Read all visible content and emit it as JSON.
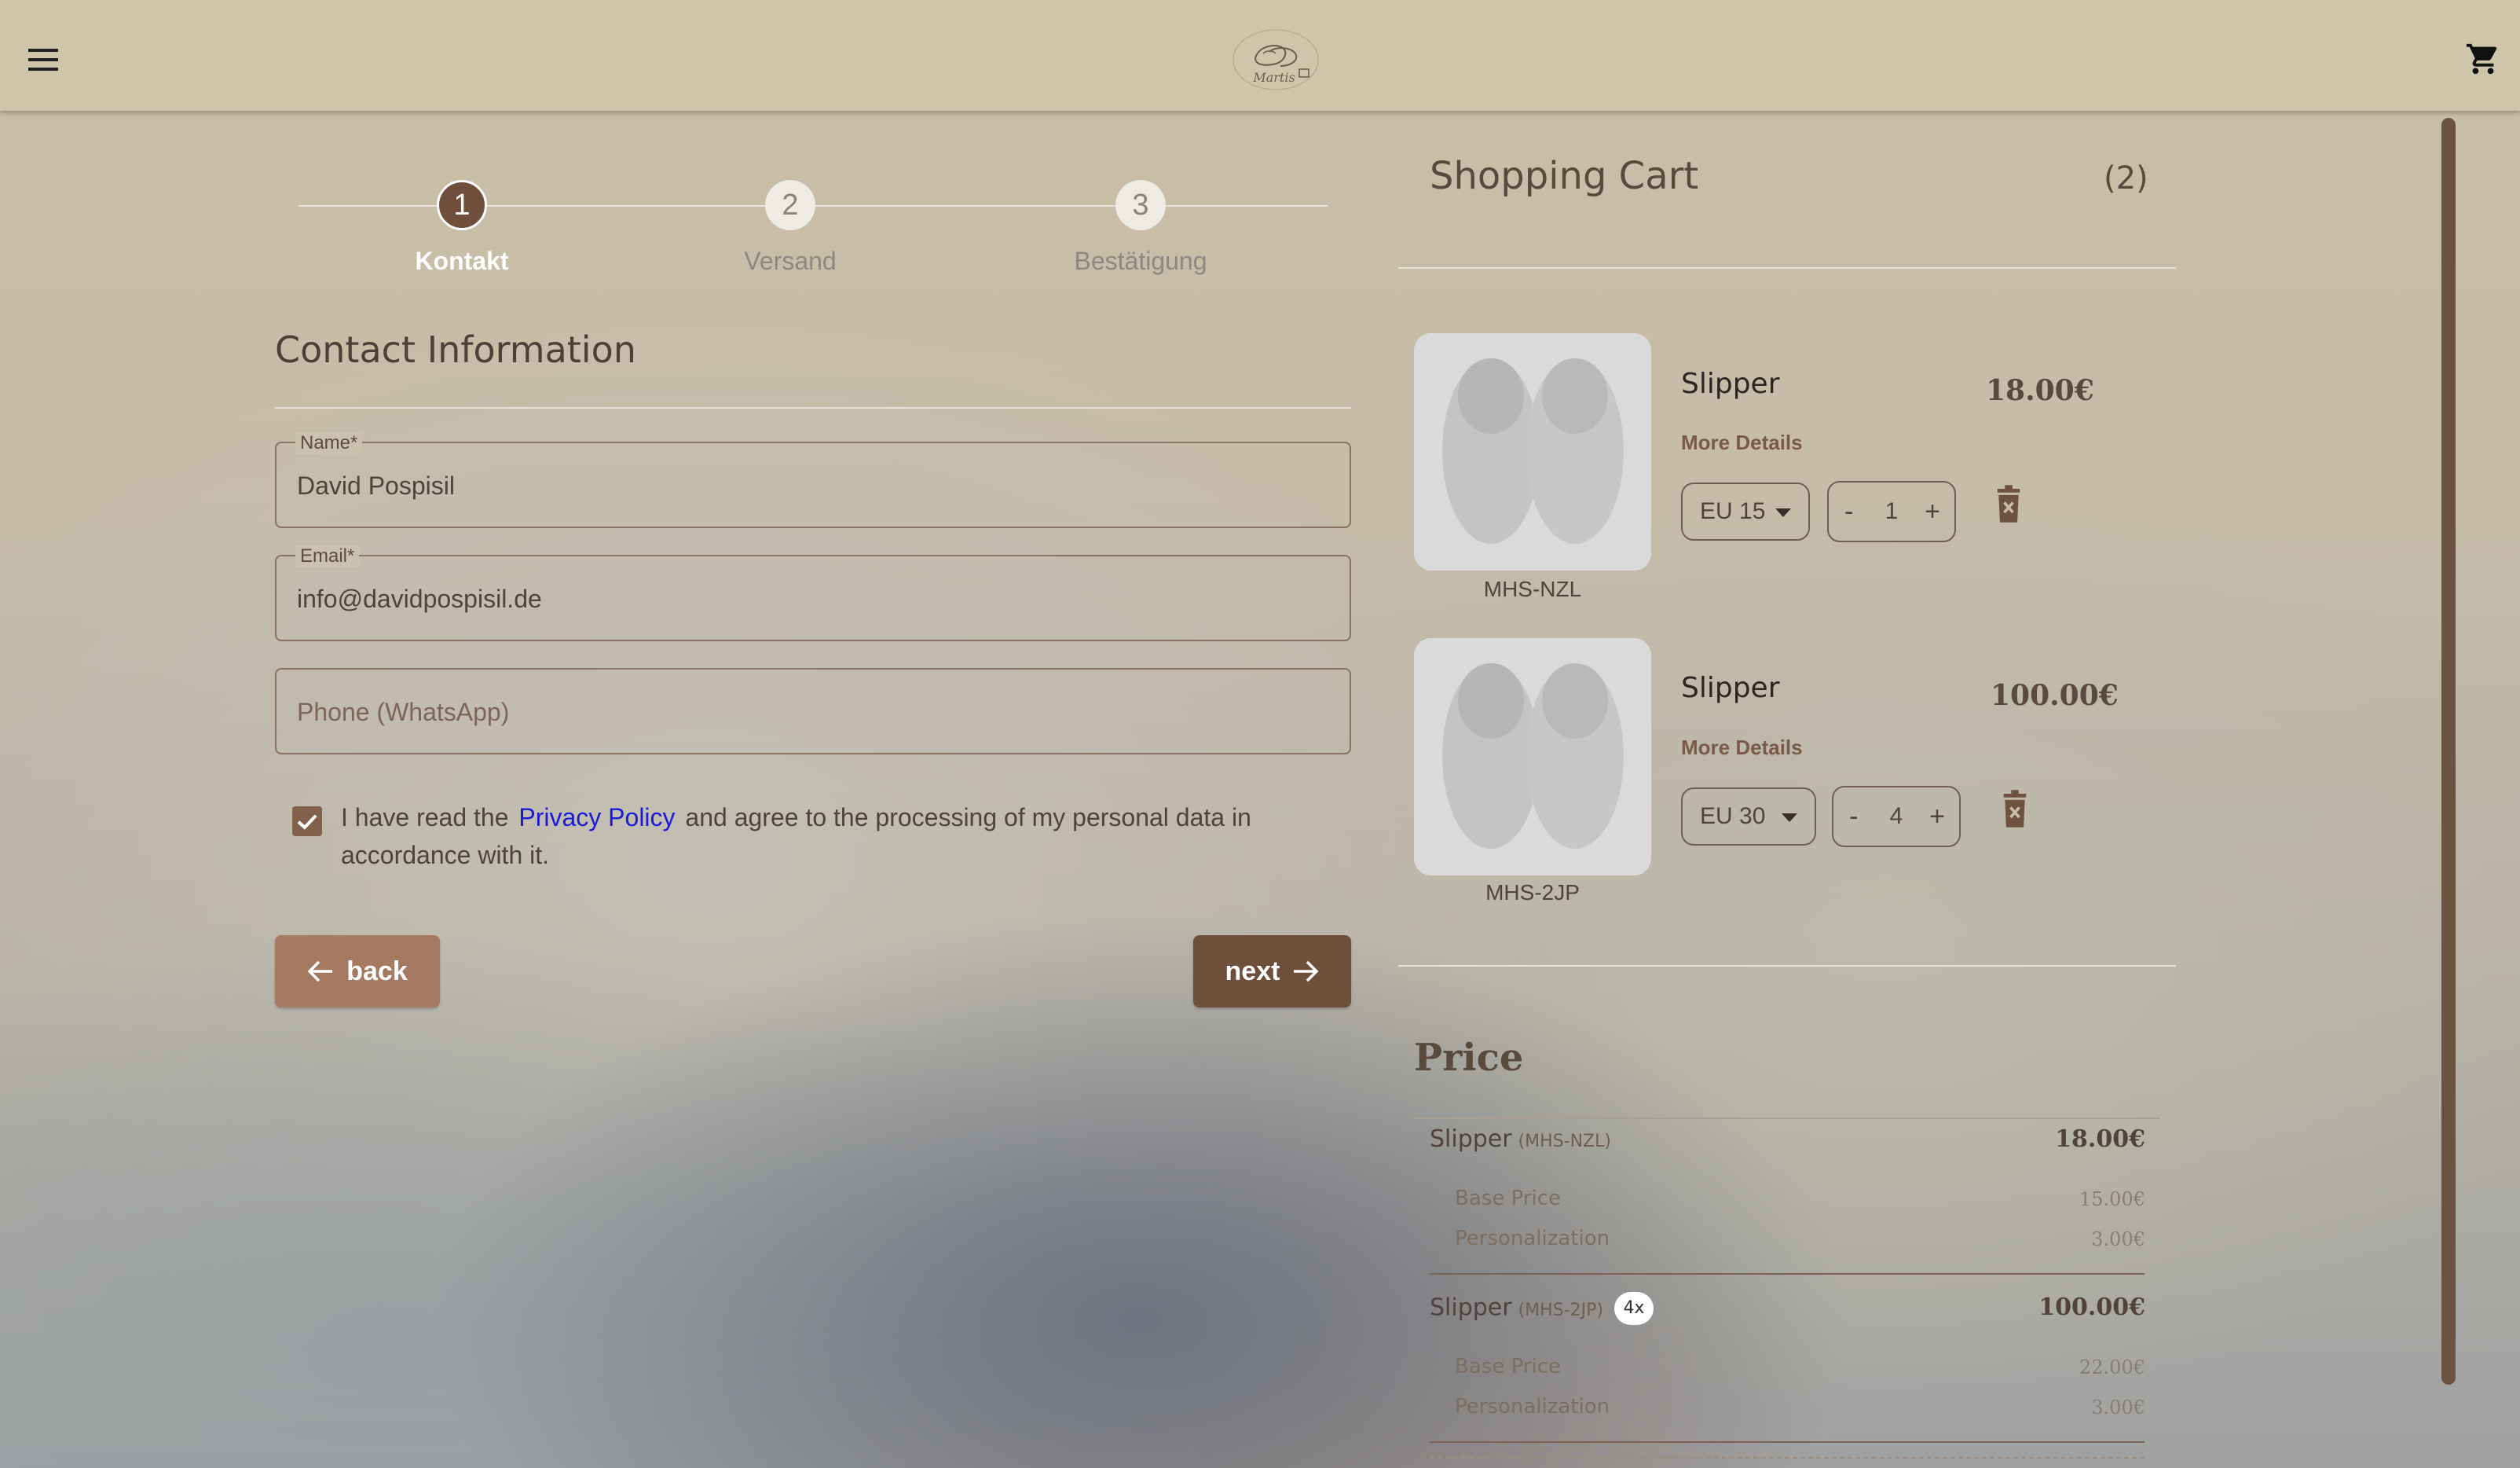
{
  "header": {
    "menu_icon": "hamburger-menu-icon",
    "logo_text": "Martis",
    "cart_icon": "shopping-cart-icon"
  },
  "stepper": {
    "steps": [
      {
        "number": "1",
        "label": "Kontakt",
        "active": true
      },
      {
        "number": "2",
        "label": "Versand",
        "active": false
      },
      {
        "number": "3",
        "label": "Bestätigung",
        "active": false
      }
    ]
  },
  "contact": {
    "title": "Contact Information",
    "name_label": "Name",
    "name_value": "David Pospisil",
    "email_label": "Email",
    "email_value": "info@davidpospisil.de",
    "phone_placeholder": "Phone (WhatsApp)",
    "required_mark": "*",
    "consent_prefix": "I have read the",
    "consent_link": "Privacy Policy",
    "consent_suffix": "and agree to the processing of my personal data in accordance with it.",
    "back_label": "back",
    "next_label": "next"
  },
  "cart": {
    "title": "Shopping Cart",
    "count": "(2)",
    "more_details": "More Details",
    "items": [
      {
        "name": "Slipper",
        "price": "18.00€",
        "sku": "MHS-NZL",
        "size": "EU 15",
        "qty": "1"
      },
      {
        "name": "Slipper",
        "price": "100.00€",
        "sku": "MHS-2JP",
        "size": "EU 30",
        "qty": "4"
      }
    ]
  },
  "price": {
    "title": "Price",
    "lines": [
      {
        "name": "Slipper",
        "sku": "(MHS-NZL)",
        "total": "18.00€",
        "badge": "",
        "base_label": "Base Price",
        "base_value": "15.00€",
        "pers_label": "Personalization",
        "pers_value": "3.00€"
      },
      {
        "name": "Slipper",
        "sku": "(MHS-2JP)",
        "total": "100.00€",
        "badge": "4x",
        "base_label": "Base Price",
        "base_value": "22.00€",
        "pers_label": "Personalization",
        "pers_value": "3.00€"
      }
    ]
  },
  "colors": {
    "accent_dark": "#6e4f3b",
    "accent_light": "#a57a62",
    "header_bg": "#cfc5aa",
    "link": "#1a1ad8"
  }
}
